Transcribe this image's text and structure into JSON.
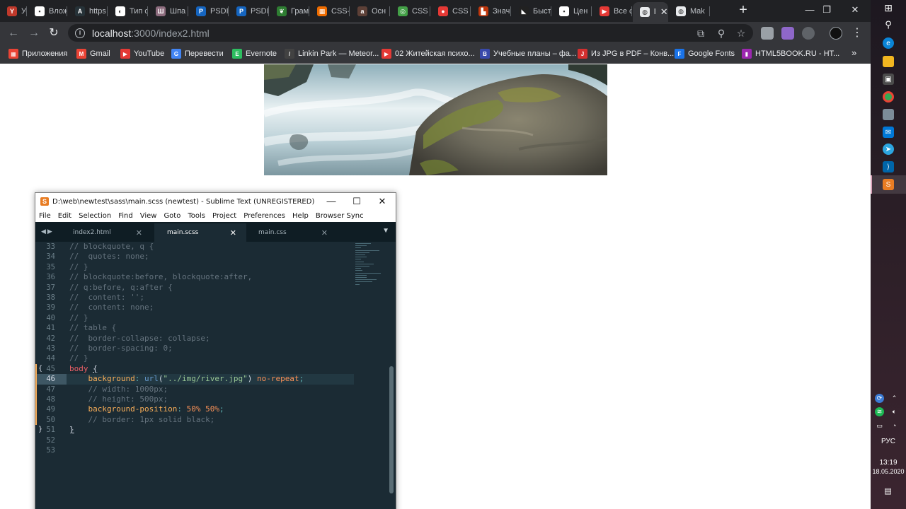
{
  "browser": {
    "tabs": [
      {
        "label": "Усло",
        "color": "#c0392b",
        "glyph": "Y",
        "icon": "yandex-icon"
      },
      {
        "label": "Влож",
        "color": "#ffffff",
        "glyph": "▪",
        "icon": "comment-icon"
      },
      {
        "label": "https",
        "color": "#263238",
        "glyph": "A",
        "icon": "angular-icon"
      },
      {
        "label": "Тип с",
        "color": "#ffffff",
        "glyph": "◐",
        "icon": "theme-icon"
      },
      {
        "label": "Шпа",
        "color": "#8e6d7f",
        "glyph": "Ш",
        "icon": "bookmark-icon"
      },
      {
        "label": "PSDI",
        "color": "#1565c0",
        "glyph": "P",
        "icon": "psd-icon"
      },
      {
        "label": "PSDI",
        "color": "#1565c0",
        "glyph": "P",
        "icon": "psd-icon"
      },
      {
        "label": "Грам",
        "color": "#2e7d32",
        "glyph": "❦",
        "icon": "leaf-icon"
      },
      {
        "label": "CSS-",
        "color": "#ef6c00",
        "glyph": "▦",
        "icon": "css-icon"
      },
      {
        "label": "Осн",
        "color": "#5d4037",
        "glyph": "a",
        "icon": "doc-icon"
      },
      {
        "label": "CSS",
        "color": "#43a047",
        "glyph": "◎",
        "icon": "globe-icon"
      },
      {
        "label": "CSS",
        "color": "#e53935",
        "glyph": "●",
        "icon": "record-icon"
      },
      {
        "label": "Знач",
        "color": "#bf360c",
        "glyph": "▙",
        "icon": "stack-icon"
      },
      {
        "label": "Быст",
        "color": "#212121",
        "glyph": "◣",
        "icon": "dark-icon"
      },
      {
        "label": "Цен",
        "color": "#ffffff",
        "glyph": "▪",
        "icon": "chat-icon"
      },
      {
        "label": "Все с",
        "color": "#e53935",
        "glyph": "▶",
        "icon": "youtube-icon"
      },
      {
        "label": "l",
        "color": "#e8eaed",
        "glyph": "◍",
        "icon": "globe-icon",
        "active": true
      },
      {
        "label": "Mak",
        "color": "#e8eaed",
        "glyph": "◍",
        "icon": "globe-icon"
      }
    ],
    "url_host": "localhost",
    "url_path": ":3000/index2.html",
    "bookmarks": [
      {
        "label": "Приложения",
        "color": "#ea4335",
        "glyph": "▦",
        "icon": "apps-icon"
      },
      {
        "label": "Gmail",
        "color": "#ea4335",
        "glyph": "M",
        "icon": "gmail-icon"
      },
      {
        "label": "YouTube",
        "color": "#e53935",
        "glyph": "▶",
        "icon": "youtube-icon"
      },
      {
        "label": "Перевести",
        "color": "#4285f4",
        "glyph": "G",
        "icon": "translate-icon"
      },
      {
        "label": "Evernote",
        "color": "#2dbe60",
        "glyph": "E",
        "icon": "evernote-icon"
      },
      {
        "label": "Linkin Park — Meteor...",
        "color": "#424242",
        "glyph": "/",
        "icon": "music-icon"
      },
      {
        "label": "02 Житейская психо...",
        "color": "#e53935",
        "glyph": "▶",
        "icon": "youtube-icon"
      },
      {
        "label": "Учебные планы – фа...",
        "color": "#3949ab",
        "glyph": "B",
        "icon": "university-icon"
      },
      {
        "label": "Из JPG в PDF – Конв...",
        "color": "#d32f2f",
        "glyph": "J",
        "icon": "pdf-icon"
      },
      {
        "label": "Google Fonts",
        "color": "#1a73e8",
        "glyph": "F",
        "icon": "fonts-icon"
      },
      {
        "label": "HTML5BOOK.RU - HT...",
        "color": "#9c27b0",
        "glyph": "▮",
        "icon": "book-icon"
      }
    ],
    "more": "»"
  },
  "sublime": {
    "title": "D:\\web\\newtest\\sass\\main.scss (newtest) - Sublime Text (UNREGISTERED)",
    "menu": [
      "File",
      "Edit",
      "Selection",
      "Find",
      "View",
      "Goto",
      "Tools",
      "Project",
      "Preferences",
      "Help",
      "Browser Sync"
    ],
    "tabs": [
      {
        "label": "index2.html",
        "active": false
      },
      {
        "label": "main.scss",
        "active": true
      },
      {
        "label": "main.css",
        "active": false
      }
    ],
    "lines": [
      {
        "n": "33",
        "tokens": [
          [
            "c-comment",
            "// blockquote, q {"
          ]
        ]
      },
      {
        "n": "34",
        "tokens": [
          [
            "c-comment",
            "//  quotes: none;"
          ]
        ]
      },
      {
        "n": "35",
        "tokens": [
          [
            "c-comment",
            "// }"
          ]
        ]
      },
      {
        "n": "36",
        "tokens": [
          [
            "c-comment",
            "// blockquote:before, blockquote:after,"
          ]
        ]
      },
      {
        "n": "37",
        "tokens": [
          [
            "c-comment",
            "// q:before, q:after {"
          ]
        ]
      },
      {
        "n": "38",
        "tokens": [
          [
            "c-comment",
            "//  content: '';"
          ]
        ]
      },
      {
        "n": "39",
        "tokens": [
          [
            "c-comment",
            "//  content: none;"
          ]
        ]
      },
      {
        "n": "40",
        "tokens": [
          [
            "c-comment",
            "// }"
          ]
        ]
      },
      {
        "n": "41",
        "tokens": [
          [
            "c-comment",
            "// table {"
          ]
        ]
      },
      {
        "n": "42",
        "tokens": [
          [
            "c-comment",
            "//  border-collapse: collapse;"
          ]
        ]
      },
      {
        "n": "43",
        "tokens": [
          [
            "c-comment",
            "//  border-spacing: 0;"
          ]
        ]
      },
      {
        "n": "44",
        "tokens": [
          [
            "c-comment",
            "// }"
          ]
        ]
      },
      {
        "n": "45",
        "fold": "{",
        "mod": true,
        "tokens": [
          [
            "c-sel",
            "body"
          ],
          [
            "c-plain",
            " "
          ],
          [
            "c-brace",
            "{"
          ]
        ]
      },
      {
        "n": "46",
        "cur": true,
        "mod": true,
        "tokens": [
          [
            "c-plain",
            "    "
          ],
          [
            "c-prop",
            "background"
          ],
          [
            "c-punc",
            ": "
          ],
          [
            "c-func",
            "url"
          ],
          [
            "c-plain",
            "("
          ],
          [
            "c-str",
            "\"../img/river.jpg\""
          ],
          [
            "c-plain",
            ") "
          ],
          [
            "c-kw",
            "no-repeat"
          ],
          [
            "c-punc",
            ";"
          ]
        ]
      },
      {
        "n": "47",
        "mod": true,
        "tokens": [
          [
            "c-plain",
            "    "
          ],
          [
            "c-comment",
            "// width: 1000px;"
          ]
        ]
      },
      {
        "n": "48",
        "mod": true,
        "tokens": [
          [
            "c-plain",
            "    "
          ],
          [
            "c-comment",
            "// height: 500px;"
          ]
        ]
      },
      {
        "n": "49",
        "mod": true,
        "tokens": [
          [
            "c-plain",
            "    "
          ],
          [
            "c-prop",
            "background-position"
          ],
          [
            "c-punc",
            ": "
          ],
          [
            "c-num",
            "50% 50%"
          ],
          [
            "c-punc",
            ";"
          ]
        ]
      },
      {
        "n": "50",
        "mod": true,
        "tokens": [
          [
            "c-plain",
            "    "
          ],
          [
            "c-comment",
            "// border: 1px solid black;"
          ]
        ]
      },
      {
        "n": "51",
        "fold": "}",
        "tokens": [
          [
            "c-brace",
            "}"
          ]
        ]
      },
      {
        "n": "52",
        "tokens": []
      },
      {
        "n": "53",
        "tokens": []
      }
    ]
  },
  "taskbar": {
    "lang": "РУС",
    "time": "13:19",
    "date": "18.05.2020"
  },
  "colors": {
    "chrome_frame": "#202124",
    "chrome_toolbar": "#35363a",
    "editor_bg": "#1b2b34",
    "accent_orange": "#f9ae58"
  }
}
